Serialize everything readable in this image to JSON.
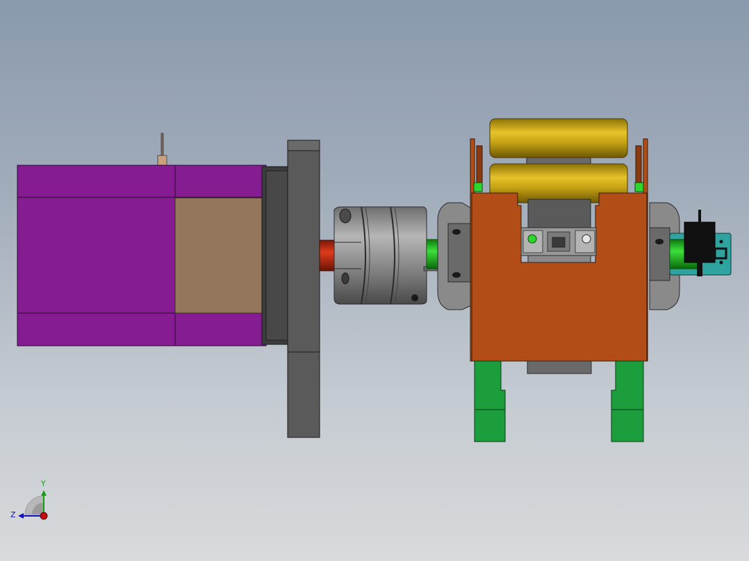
{
  "viewport": {
    "background_top": "#8a99ad",
    "background_bottom": "#d8dadc"
  },
  "model": {
    "components": [
      {
        "name": "servo-motor",
        "color": "#851c91"
      },
      {
        "name": "motor-adapter-block",
        "color": "#94765c"
      },
      {
        "name": "mounting-flange-plate",
        "color": "#5a5a5a"
      },
      {
        "name": "motor-shaft",
        "color": "#c22a12"
      },
      {
        "name": "shaft-coupling",
        "color": "#7e7e7e"
      },
      {
        "name": "input-shaft",
        "color": "#1ec21e"
      },
      {
        "name": "gearbox-housing",
        "color": "#b24d17"
      },
      {
        "name": "yellow-roller",
        "color": "#c8a416"
      },
      {
        "name": "green-support-leg",
        "color": "#1c9e3c"
      },
      {
        "name": "teal-sensor-bracket",
        "color": "#2fa3a0"
      },
      {
        "name": "black-connector",
        "color": "#111111"
      }
    ]
  },
  "triad": {
    "y_label": "Y",
    "z_label": "Z",
    "y_color": "#10a010",
    "z_color": "#1010c0",
    "x_color": "#c01010"
  }
}
